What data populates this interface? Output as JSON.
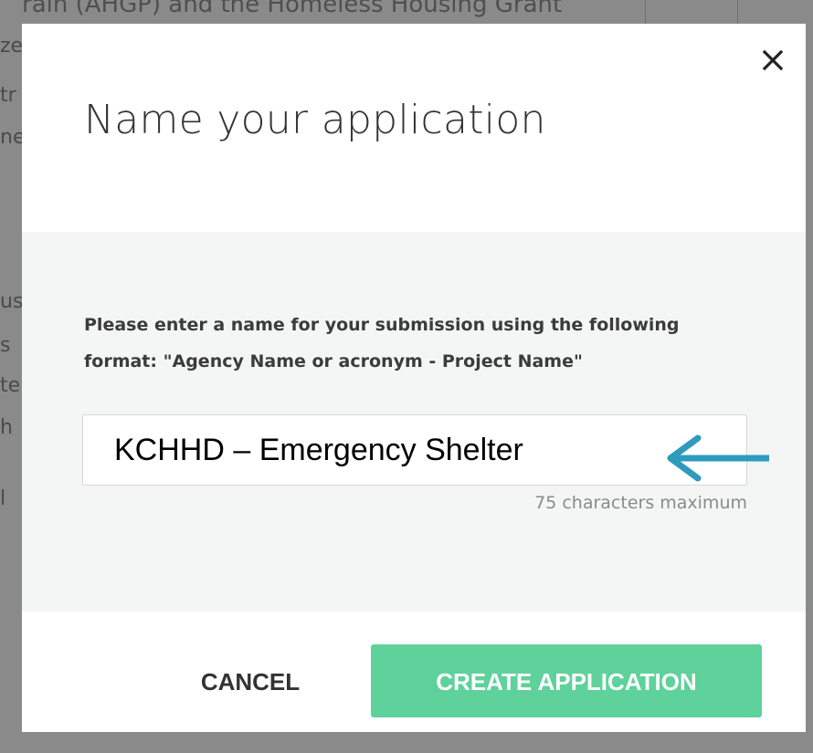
{
  "background": {
    "top_line": "rain (AHGP) and the Homeless Housing Grant",
    "fragments": [
      "ze",
      "tr",
      "ne",
      "us",
      "s",
      "te",
      "h",
      "l"
    ]
  },
  "modal": {
    "title": "Name your application",
    "close_icon": "close-x-icon",
    "prompt": "Please enter a name for your submission using the following format: \"Agency Name or acronym - Project Name\"",
    "input": {
      "value": "KCHHD – Emergency Shelter",
      "placeholder": ""
    },
    "char_limit": "75 characters maximum",
    "annotation_arrow": "left-arrow-icon",
    "cancel_label": "CANCEL",
    "create_label": "CREATE APPLICATION"
  },
  "colors": {
    "primary_button": "#5fd19b",
    "arrow": "#2e9bbd",
    "body_band": "#f4f5f5",
    "overlay": "#8a8a8a"
  }
}
